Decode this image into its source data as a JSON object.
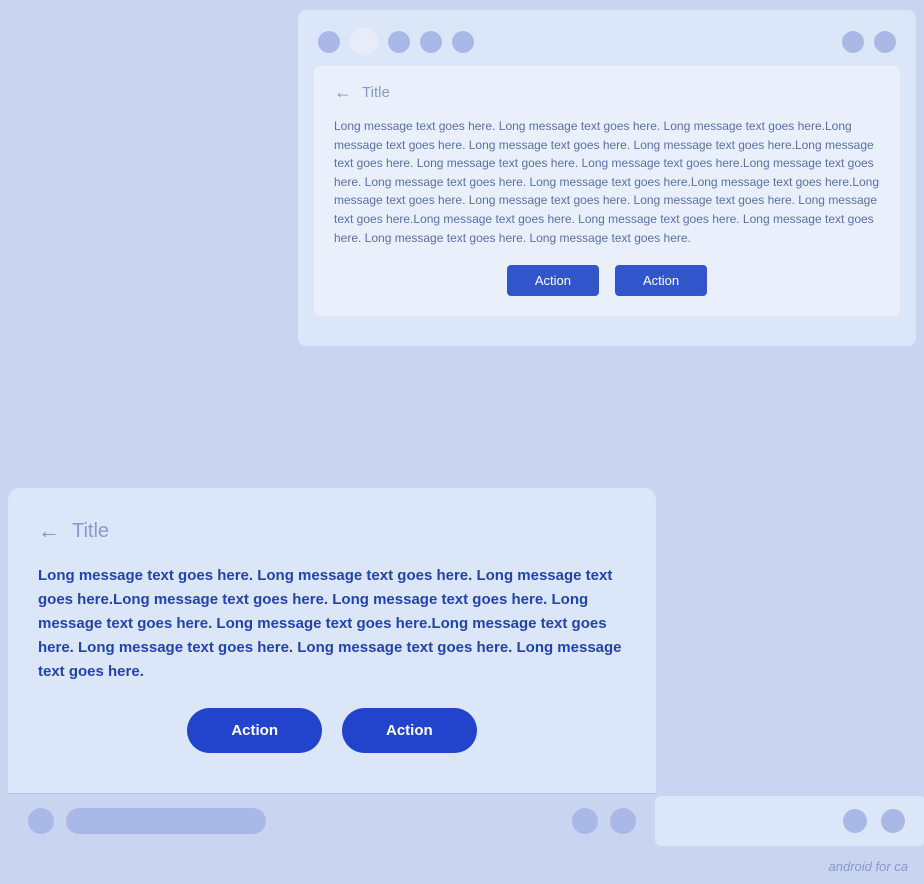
{
  "top_card": {
    "dots": [
      {
        "size": "small",
        "active": false
      },
      {
        "size": "medium",
        "active": true
      },
      {
        "size": "small",
        "active": false
      },
      {
        "size": "small",
        "active": false
      },
      {
        "size": "small",
        "active": false
      }
    ],
    "right_dots": [
      {
        "size": "small"
      },
      {
        "size": "small"
      }
    ],
    "back_arrow": "←",
    "title": "Title",
    "body_text": "Long message text goes here. Long message text goes here. Long message text goes here.Long message text goes here. Long message text goes here. Long message text goes here.Long message text goes here. Long message text goes here. Long message text goes here.Long message text goes here. Long message text goes here. Long message text goes here.Long message text goes here.Long message text goes here. Long message text goes here. Long message text goes here. Long message text goes here.Long message text goes here. Long message text goes here. Long message text goes here. Long message text goes here. Long message text goes here.",
    "button1_label": "Action",
    "button2_label": "Action"
  },
  "bottom_card": {
    "back_arrow": "←",
    "title": "Title",
    "body_text": "Long message text goes here. Long message text goes here. Long message text goes here.Long message text goes here. Long message text goes here. Long message text goes here. Long message text goes here.Long message text goes here. Long message text goes here. Long message text goes here. Long message text goes here.",
    "button1_label": "Action",
    "button2_label": "Action"
  },
  "right_panel": {},
  "watermark": "android for ca"
}
